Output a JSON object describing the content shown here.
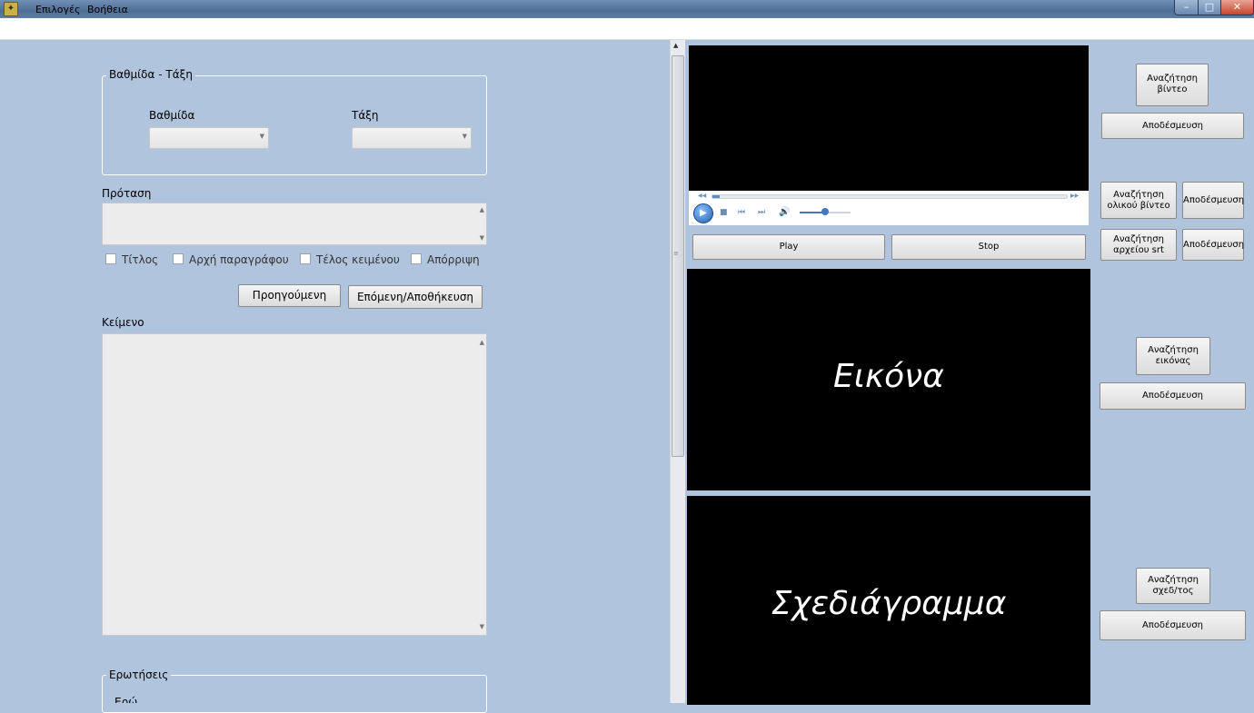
{
  "window": {
    "minimize_glyph": "–",
    "maximize_glyph": "□",
    "close_glyph": "✕"
  },
  "menu": {
    "options": "Επιλογές",
    "help": "Βοήθεια"
  },
  "class_group": {
    "title": "Βαθμίδα - Τάξη",
    "level_label": "Βαθμίδα",
    "level_value": "",
    "class_label": "Τάξη",
    "class_value": ""
  },
  "sentence": {
    "label": "Πρόταση",
    "value": "",
    "checkboxes": [
      {
        "label": "Τίτλος",
        "checked": false
      },
      {
        "label": "Αρχή παραγράφου",
        "checked": false
      },
      {
        "label": "Τέλος κειμένου",
        "checked": false
      },
      {
        "label": "Απόρριψη",
        "checked": false
      }
    ],
    "prev_button": "Προηγούμενη",
    "next_button": "Επόμενη/Αποθήκευση"
  },
  "text": {
    "label": "Κείμενο",
    "value": ""
  },
  "questions": {
    "title": "Ερωτήσεις",
    "partial_label": "Ερώ"
  },
  "video": {
    "play_button": "Play",
    "stop_button": "Stop",
    "seek_progress": 0.02,
    "volume_level": 0.5,
    "search_video_button": "Αναζήτηση\nβίντεο",
    "release_video_button": "Αποδέσμευση",
    "search_full_video_button": "Αναζήτηση\nολικού βίντεο",
    "release_full_video_button": "Αποδέσμευση",
    "search_srt_button": "Αναζήτηση\nαρχείου srt",
    "release_srt_button": "Αποδέσμευση"
  },
  "image": {
    "placeholder": "Εικόνα",
    "search_button": "Αναζήτηση\nεικόνας",
    "release_button": "Αποδέσμευση"
  },
  "diagram": {
    "placeholder": "Σχεδιάγραμμα",
    "search_button": "Αναζήτηση\nσχεδ/τος",
    "release_button": "Αποδέσμευση"
  },
  "colors": {
    "background": "#b0c4de",
    "panel_black": "#000000",
    "player_bg": "#ffffff"
  }
}
